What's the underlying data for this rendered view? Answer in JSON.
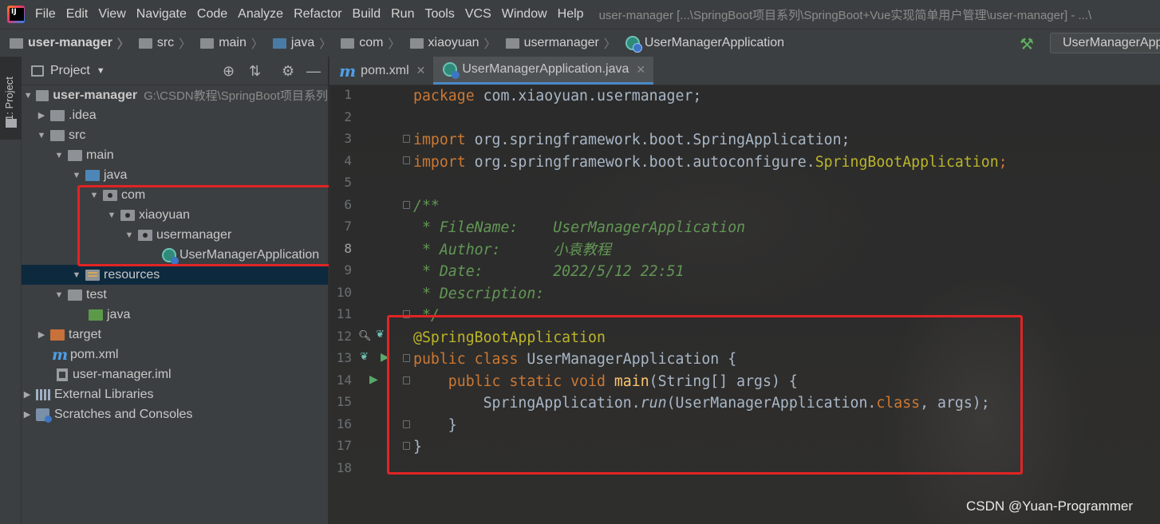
{
  "menubar": {
    "items": [
      "File",
      "Edit",
      "View",
      "Navigate",
      "Code",
      "Analyze",
      "Refactor",
      "Build",
      "Run",
      "Tools",
      "VCS",
      "Window",
      "Help"
    ],
    "window_title": "user-manager [...\\SpringBoot项目系列\\SpringBoot+Vue实现简单用户管理\\user-manager] - ...\\"
  },
  "navbar": {
    "crumbs": [
      "user-manager",
      "src",
      "main",
      "java",
      "com",
      "xiaoyuan",
      "usermanager",
      "UserManagerApplication"
    ],
    "run_config": "UserManagerApplication"
  },
  "leftstrip": {
    "tab_label": "1: Project"
  },
  "project": {
    "title": "Project",
    "root": {
      "name": "user-manager",
      "path": "G:\\CSDN教程\\SpringBoot项目系列"
    },
    "nodes": {
      "idea": ".idea",
      "src": "src",
      "main": "main",
      "java": "java",
      "com": "com",
      "xiaoyuan": "xiaoyuan",
      "usermanager": "usermanager",
      "app_class": "UserManagerApplication",
      "resources": "resources",
      "test": "test",
      "test_java": "java",
      "target": "target",
      "pom": "pom.xml",
      "iml": "user-manager.iml",
      "ext_libs": "External Libraries",
      "scratches": "Scratches and Consoles"
    }
  },
  "editor": {
    "tabs": [
      {
        "label": "pom.xml",
        "active": false
      },
      {
        "label": "UserManagerApplication.java",
        "active": true
      }
    ],
    "line_numbers": [
      "1",
      "2",
      "3",
      "4",
      "5",
      "6",
      "7",
      "8",
      "9",
      "10",
      "11",
      "12",
      "13",
      "14",
      "15",
      "16",
      "17",
      "18"
    ],
    "current_line": "8",
    "code": {
      "l1_kw": "package",
      "l1_rest": " com.xiaoyuan.usermanager;",
      "l3_kw": "import",
      "l3_rest": " org.springframework.boot.SpringApplication;",
      "l4_kw": "import",
      "l4_rest": " org.springframework.boot.autoconfigure.",
      "l4_ann": "SpringBootApplication",
      "l4_end": ";",
      "l6": "/**",
      "l7_tag": " * FileName:",
      "l7_val": "    UserManagerApplication",
      "l8_tag": " * Author:",
      "l8_val": "      小袁教程",
      "l9_tag": " * Date:",
      "l9_val": "        2022/5/12 22:51",
      "l10_tag": " * Description:",
      "l11": " */",
      "l12": "@SpringBootApplication",
      "l13_kw": "public class",
      "l13_rest": " UserManagerApplication {",
      "l14_kw": "    public static void",
      "l14_fn": " main",
      "l14_rest": "(String[] args) {",
      "l15_a": "        SpringApplication.",
      "l15_run": "run",
      "l15_b": "(UserManagerApplication.",
      "l15_cls": "class",
      "l15_c": ", args);",
      "l16": "    }",
      "l17": "}"
    }
  },
  "watermark": "CSDN @Yuan-Programmer",
  "colors": {
    "highlight_box": "#e12424",
    "accent": "#4a88c7"
  }
}
